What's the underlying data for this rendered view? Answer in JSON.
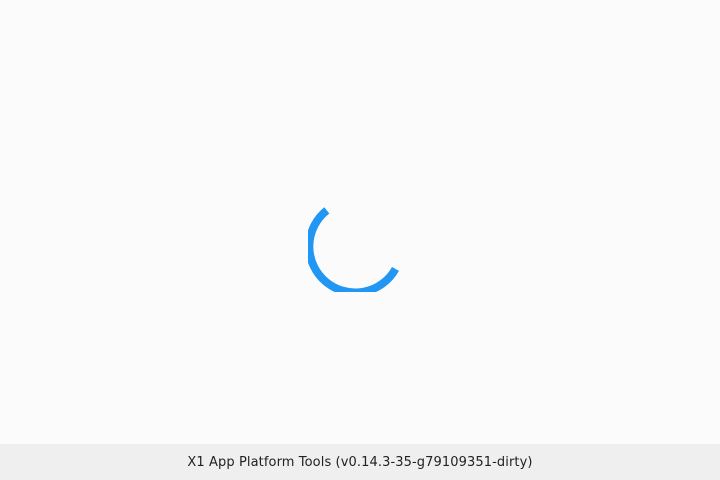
{
  "footer": {
    "version_text": "X1 App Platform Tools (v0.14.3-35-g79109351-dirty)"
  },
  "loading": {
    "icon": "loading-spinner-icon",
    "color": "#2196f3"
  },
  "colors": {
    "background": "#fbfbfb",
    "footer_background": "#efefef"
  }
}
